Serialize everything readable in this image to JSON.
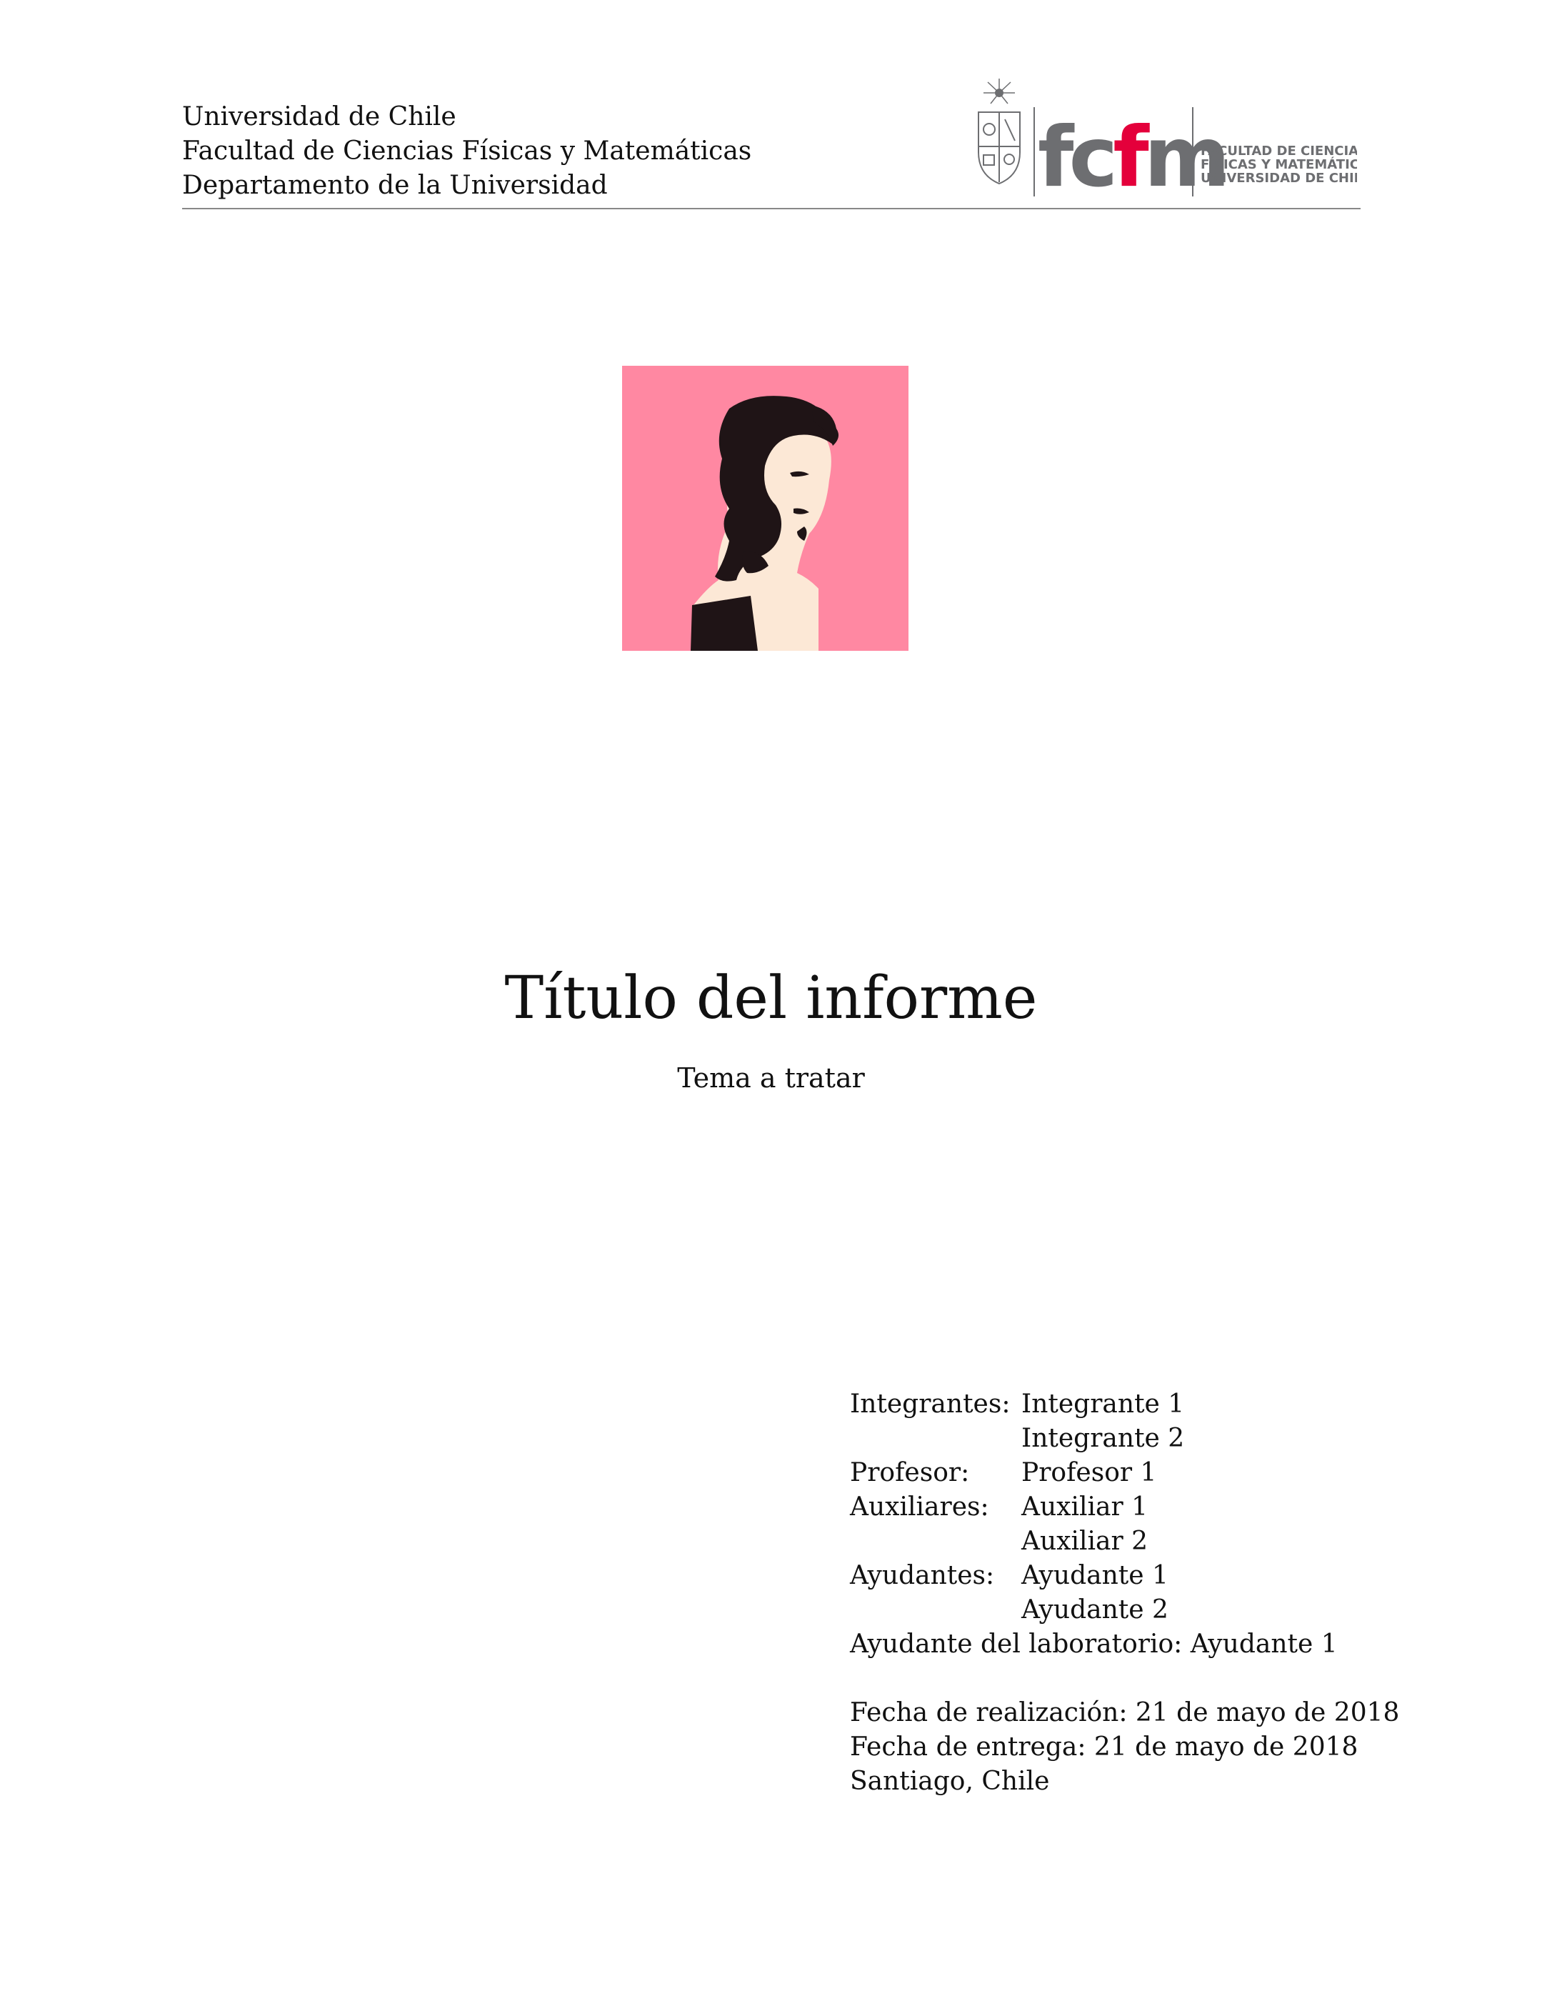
{
  "header": {
    "university": "Universidad de Chile",
    "faculty": "Facultad de Ciencias Físicas y Matemáticas",
    "department": "Departamento de la Universidad"
  },
  "logo": {
    "wordmark": "fcfm",
    "text_line1": "FACULTAD DE CIENCIAS",
    "text_line2": "FÍSICAS Y MATEMÁTICAS",
    "text_line3": "UNIVERSIDAD DE CHILE",
    "colors": {
      "gray": "#6d6e71",
      "red": "#e4003b"
    }
  },
  "cover_image": {
    "icon": "bust-portrait-illustration",
    "colors": {
      "background": "#ff88a2",
      "dark": "#1f1416",
      "skin": "#fce8d6"
    }
  },
  "title": "Título del informe",
  "subtitle": "Tema a tratar",
  "info": {
    "integrantes_label": "Integrantes:",
    "integrantes": [
      "Integrante 1",
      "Integrante 2"
    ],
    "profesor_label": "Profesor:",
    "profesor": "Profesor 1",
    "auxiliares_label": "Auxiliares:",
    "auxiliares": [
      "Auxiliar 1",
      "Auxiliar 2"
    ],
    "ayudantes_label": "Ayudantes:",
    "ayudantes": [
      "Ayudante 1",
      "Ayudante 2"
    ],
    "ayudante_lab_line": "Ayudante del laboratorio: Ayudante 1",
    "fecha_realizacion_line": "Fecha de realización: 21 de mayo de 2018",
    "fecha_entrega_line": "Fecha de entrega: 21 de mayo de 2018",
    "lugar_line": "Santiago, Chile"
  }
}
